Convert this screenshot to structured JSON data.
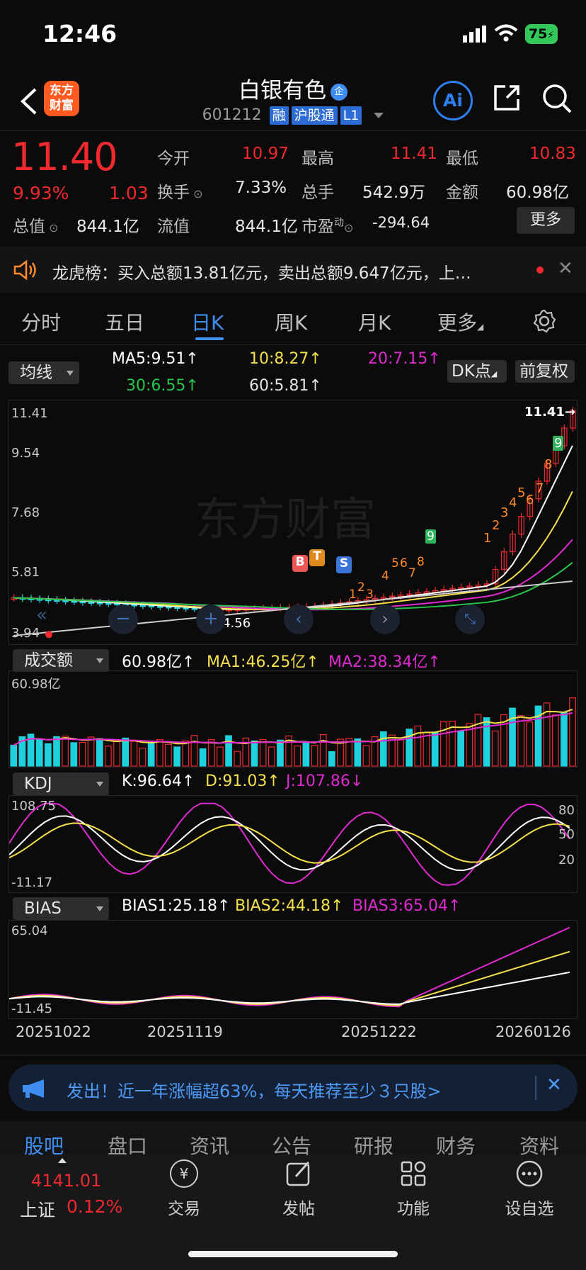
{
  "status_bar": {
    "time": "12:46",
    "battery": "75"
  },
  "header": {
    "title": "白银有色",
    "title_badge": "企",
    "code": "601212",
    "tags": [
      "融",
      "沪股通",
      "L1"
    ],
    "logo_text": "东方财富",
    "ai_label": "Ai"
  },
  "quote": {
    "price": "11.40",
    "change_pct": "9.93%",
    "change": "1.03",
    "open_label": "今开",
    "open": "10.97",
    "high_label": "最高",
    "high": "11.41",
    "low_label": "最低",
    "low": "10.83",
    "turnover_label": "换手",
    "turnover": "7.33%",
    "volume_label": "总手",
    "volume": "542.9万",
    "amount_label": "金额",
    "amount": "60.98亿",
    "total_cap_label": "总值",
    "total_cap": "844.1亿",
    "float_cap_label": "流值",
    "float_cap": "844.1亿",
    "pe_label": "市盈",
    "pe_sup": "动",
    "pe": "-294.64",
    "more_label": "更多"
  },
  "notice": {
    "text": "龙虎榜：买入总额13.81亿元，卖出总额9.647亿元，上…"
  },
  "tabs": [
    "分时",
    "五日",
    "日K",
    "周K",
    "月K",
    "更多"
  ],
  "active_tab": "日K",
  "ma_bar": {
    "selector": "均线",
    "ma5": "MA5:9.51↑",
    "ma10": "10:8.27↑",
    "ma20": "20:7.15↑",
    "ma30": "30:6.55↑",
    "ma60": "60:5.81↑",
    "dk_label": "DK点",
    "fq_label": "前复权"
  },
  "kline": {
    "axis": [
      "11.41",
      "9.54",
      "7.68",
      "5.81",
      "3.94"
    ],
    "max_marker": "11.41→",
    "min_marker": "←4.56",
    "watermark": "东方财富",
    "signals": [
      "B",
      "T",
      "S"
    ],
    "td_counts_a": [
      "1",
      "2",
      "3",
      "4",
      "5",
      "6",
      "7",
      "8",
      "9"
    ],
    "td_counts_b": [
      "1",
      "2",
      "3",
      "4",
      "5",
      "6",
      "7",
      "8",
      "9"
    ]
  },
  "volume": {
    "selector": "成交额",
    "value": "60.98亿↑",
    "ma1": "MA1:46.25亿↑",
    "ma2": "MA2:38.34亿↑",
    "axis_top": "60.98亿"
  },
  "kdj": {
    "selector": "KDJ",
    "k": "K:96.64↑",
    "d": "D:91.03↑",
    "j": "J:107.86↓",
    "axis_top": "108.75",
    "axis_bottom": "-11.17",
    "levels": [
      "80",
      "50",
      "20"
    ]
  },
  "bias": {
    "selector": "BIAS",
    "b1": "BIAS1:25.18↑",
    "b2": "BIAS2:44.18↑",
    "b3": "BIAS3:65.04↑",
    "axis_top": "65.04",
    "axis_bottom": "-11.45"
  },
  "dates": [
    "20251022",
    "20251119",
    "20251222",
    "20260126"
  ],
  "ad": {
    "text": "发出！近一年涨幅超63%，每天推荐至少３只股>"
  },
  "sub_tabs": [
    "股吧",
    "盘口",
    "资讯",
    "公告",
    "研报",
    "财务",
    "资料"
  ],
  "bottom_nav": {
    "index_value": "4141.01",
    "index_name": "上证",
    "index_change": "0.12%",
    "items": [
      "交易",
      "发帖",
      "功能",
      "设自选"
    ]
  },
  "colors": {
    "up": "#f0292e",
    "down": "#1fd1dc",
    "accent": "#3d8ef0",
    "ma5": "#ffffff",
    "ma10": "#f5e04a",
    "ma20": "#e02ad0",
    "ma30": "#27c64a",
    "ma60": "#cccccc"
  }
}
